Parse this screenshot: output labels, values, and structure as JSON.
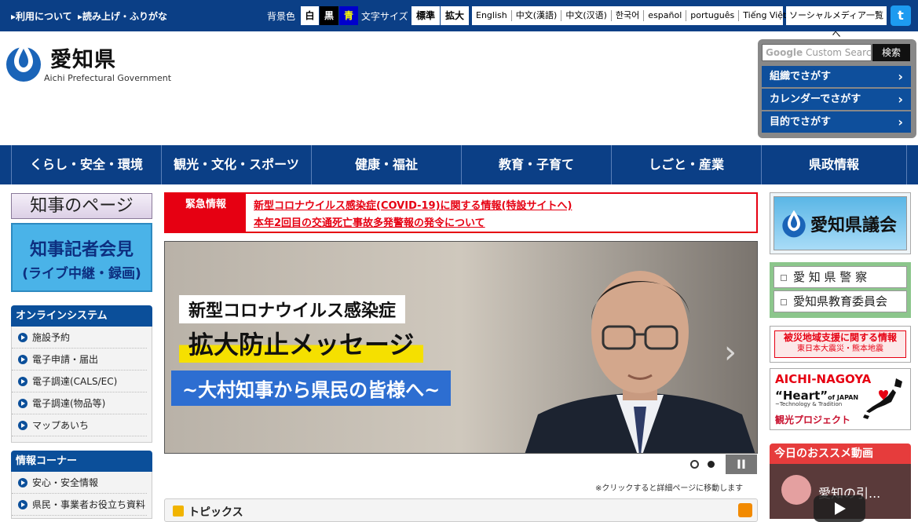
{
  "topbar": {
    "links": [
      "利用について",
      "読み上げ・ふりがな"
    ],
    "bg_label": "背景色",
    "bg_options": [
      "白",
      "黒",
      "青"
    ],
    "text_size_label": "文字サイズ",
    "text_size_options": [
      "標準",
      "拡大"
    ],
    "languages": [
      "English",
      "中文(漢語)",
      "中文(汉语)",
      "한국어",
      "español",
      "português",
      "Tiếng Việt"
    ],
    "social_link": "ソーシャルメディア一覧へ",
    "colors": {
      "bar": "#0b3f86",
      "black_option": "#000000",
      "blue_option": "#0000cc",
      "blue_option_text": "#ffff00"
    }
  },
  "logo": {
    "name": "愛知県",
    "subtitle": "Aichi Prefectural Government"
  },
  "search": {
    "placeholder": "Custom Search",
    "button": "検索",
    "nav": [
      "組織でさがす",
      "カレンダーでさがす",
      "目的でさがす"
    ]
  },
  "global_nav": [
    "くらし・安全・環境",
    "観光・文化・スポーツ",
    "健康・福祉",
    "教育・子育て",
    "しごと・産業",
    "県政情報"
  ],
  "left": {
    "governor_page": "知事のページ",
    "press": {
      "line1": "知事記者会見",
      "line2": "(ライブ中継・録画)"
    },
    "online": {
      "title": "オンラインシステム",
      "items": [
        "施設予約",
        "電子申請・届出",
        "電子調達(CALS/EC)",
        "電子調達(物品等)",
        "マップあいち"
      ]
    },
    "info": {
      "title": "情報コーナー",
      "items": [
        "安心・安全情報",
        "県民・事業者お役立ち資料"
      ]
    }
  },
  "emergency": {
    "label": "緊急情報",
    "links": [
      "新型コロナウイルス感染症(COVID-19)に関する情報(特設サイトへ)",
      "本年2回目の交通死亡事故多発警報の発令について"
    ],
    "color": "#e60012"
  },
  "slideshow": {
    "caption1": "新型コロナウイルス感染症",
    "caption2": "拡大防止メッセージ",
    "caption3": "~大村知事から県民の皆様へ~",
    "total_slides": 2,
    "pause_label": "II",
    "note": "※クリックすると詳細ページに移動します"
  },
  "topics": {
    "title": "トピックス"
  },
  "right": {
    "assembly": "愛知県議会",
    "police_edu": [
      "愛 知 県 警 察",
      "愛知県教育委員会"
    ],
    "disaster": {
      "line1": "被災地域支援に関する情報",
      "line2": "東日本大震災・熊本地震"
    },
    "heart": {
      "line1": "AICHI-NAGOYA",
      "line2": "“Heart”",
      "line2_suffix": "of JAPAN",
      "line3": "~Technology & Tradition",
      "line4": "観光プロジェクト"
    },
    "video_title": "今日のおススメ動画",
    "video_caption": "愛知の引..."
  }
}
